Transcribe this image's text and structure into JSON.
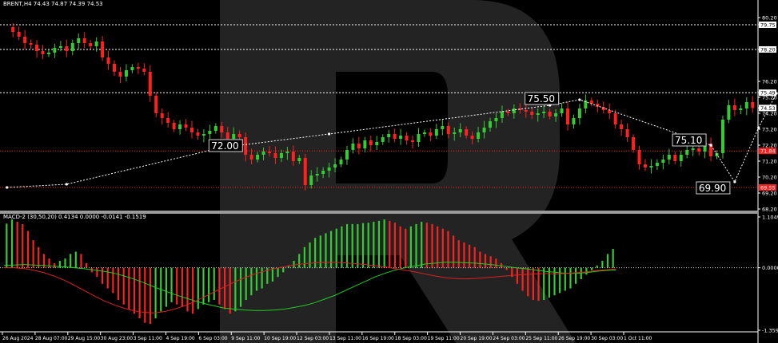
{
  "main_header": "BRENT,H4 74.43 74.87 74.39 74.53",
  "macd_header": "MACD-2 (30,50,20) 0.4134 0.0000 -0.0141 -0.1519",
  "colors": {
    "background": "#000000",
    "bull": "#33cc33",
    "bear": "#ff2020",
    "level_line": "#ff2020",
    "projection": "#ffffff",
    "signal_green": "#22cc22",
    "signal_red": "#dd2020"
  },
  "chart_data": [
    {
      "type": "candlestick",
      "symbol": "BRENT",
      "timeframe": "H4",
      "ylim": [
        68.2,
        80.7
      ],
      "y_ticks": [
        "80.20",
        "79.75",
        "78.20",
        "76.20",
        "75.49",
        "75.20",
        "74.53",
        "74.20",
        "73.20",
        "72.20",
        "71.20",
        "70.20",
        "69.20",
        "68.20"
      ],
      "x_ticks": [
        "26 Aug 2024",
        "28 Aug 07:00",
        "29 Aug 15:00",
        "30 Aug 23:00",
        "3 Sep 11:00",
        "4 Sep 19:00",
        "6 Sep 03:00",
        "9 Sep 11:00",
        "10 Sep 19:00",
        "12 Sep 03:00",
        "13 Sep 11:00",
        "16 Sep 19:00",
        "18 Sep 03:00",
        "19 Sep 11:00",
        "20 Sep 19:00",
        "24 Sep 03:00",
        "25 Sep 11:00",
        "26 Sep 19:00",
        "30 Sep 03:00",
        "1 Oct 11:00"
      ],
      "price_tags": [
        "79.75",
        "78.20",
        "75.49",
        "74.53",
        "71.84",
        "69.55"
      ],
      "levels": [
        79.75,
        78.2,
        75.49,
        71.84,
        69.55
      ],
      "level_styles": [
        "white",
        "white",
        "white",
        "red",
        "red"
      ],
      "annotations": [
        "72.00",
        "75.50",
        "75.10",
        "69.90",
        "78.20"
      ],
      "close_path": [
        79.6,
        79.3,
        79.0,
        78.6,
        78.5,
        78.1,
        77.9,
        78.0,
        78.3,
        78.4,
        78.1,
        78.6,
        78.9,
        78.6,
        78.4,
        78.7,
        77.7,
        77.3,
        76.8,
        76.5,
        76.9,
        77.1,
        77.0,
        76.8,
        75.3,
        74.2,
        73.9,
        73.6,
        73.2,
        73.5,
        73.3,
        73.0,
        72.8,
        72.9,
        73.1,
        73.4,
        73.0,
        72.6,
        72.9,
        72.7,
        71.6,
        71.3,
        71.6,
        71.8,
        71.7,
        71.4,
        71.7,
        71.8,
        71.2,
        71.4,
        69.7,
        70.3,
        70.4,
        70.6,
        70.8,
        71.0,
        71.3,
        71.9,
        72.3,
        72.0,
        72.5,
        72.2,
        72.4,
        72.7,
        72.9,
        72.6,
        72.8,
        72.5,
        72.4,
        72.9,
        73.0,
        72.8,
        73.2,
        73.4,
        72.9,
        73.0,
        73.2,
        72.8,
        72.6,
        73.0,
        73.3,
        73.7,
        73.9,
        74.3,
        74.2,
        74.5,
        74.4,
        74.3,
        74.1,
        74.2,
        74.3,
        74.0,
        74.2,
        74.5,
        73.5,
        73.9,
        74.5,
        75.0,
        74.8,
        74.6,
        74.4,
        74.2,
        73.5,
        73.2,
        72.7,
        71.9,
        71.0,
        70.8,
        70.9,
        71.1,
        71.3,
        71.6,
        71.2,
        71.6,
        71.9,
        72.0,
        71.8,
        72.3,
        71.5,
        71.7,
        73.8,
        74.7,
        74.4,
        74.5,
        74.9,
        74.53
      ],
      "projection_path": [
        [
          0,
          69.55
        ],
        [
          10,
          69.75
        ],
        [
          36,
          72.05
        ],
        [
          54,
          72.9
        ],
        [
          91,
          74.7
        ],
        [
          96,
          75.05
        ],
        [
          118,
          72.2
        ],
        [
          122,
          69.9
        ],
        [
          126,
          73.3
        ],
        [
          129,
          75.45
        ],
        [
          133,
          74.05
        ],
        [
          137,
          71.95
        ],
        [
          142,
          75.1
        ],
        [
          147,
          78.2
        ]
      ]
    },
    {
      "type": "macd_histogram",
      "name": "MACD-2 (30,50,20)",
      "ylim": [
        -1.3595,
        1.1049
      ],
      "y_ticks": [
        "1.1049",
        "0.0000",
        "-1.3595"
      ],
      "histogram": [
        0.96,
        1.05,
        1.0,
        0.95,
        0.8,
        0.6,
        0.45,
        0.3,
        0.2,
        0.1,
        0.15,
        0.2,
        0.3,
        0.35,
        0.3,
        0.1,
        -0.1,
        -0.2,
        -0.35,
        -0.45,
        -0.55,
        -0.7,
        -0.8,
        -0.9,
        -1.0,
        -1.1,
        -1.2,
        -1.22,
        -1.1,
        -0.95,
        -0.85,
        -0.75,
        -0.8,
        -0.85,
        -0.95,
        -1.0,
        -0.9,
        -0.8,
        -0.75,
        -0.7,
        -0.8,
        -0.9,
        -1.0,
        -0.95,
        -0.85,
        -0.7,
        -0.6,
        -0.5,
        -0.45,
        -0.35,
        -0.3,
        -0.2,
        -0.1,
        0.05,
        0.15,
        0.3,
        0.45,
        0.55,
        0.65,
        0.7,
        0.75,
        0.8,
        0.85,
        0.9,
        0.95,
        0.95,
        0.95,
        0.97,
        0.98,
        1.0,
        1.02,
        1.05,
        1.02,
        0.98,
        0.9,
        0.85,
        0.9,
        0.95,
        1.0,
        0.98,
        0.95,
        0.9,
        0.85,
        0.8,
        0.7,
        0.6,
        0.55,
        0.5,
        0.45,
        0.35,
        0.3,
        0.25,
        0.2,
        0.1,
        -0.05,
        -0.2,
        -0.35,
        -0.5,
        -0.62,
        -0.7,
        -0.72,
        -0.7,
        -0.65,
        -0.6,
        -0.55,
        -0.5,
        -0.45,
        -0.35,
        -0.25,
        -0.15,
        -0.05,
        0.05,
        0.15,
        0.3,
        0.41
      ],
      "signal": [
        0.05,
        0.06,
        0.07,
        0.06,
        0.05,
        0.03,
        0.02,
        0.0,
        -0.02,
        -0.05,
        -0.08,
        -0.12,
        -0.18,
        -0.25,
        -0.33,
        -0.42,
        -0.5,
        -0.58,
        -0.65,
        -0.72,
        -0.78,
        -0.83,
        -0.88,
        -0.9,
        -0.92,
        -0.93,
        -0.93,
        -0.92,
        -0.9,
        -0.86,
        -0.82,
        -0.76,
        -0.68,
        -0.6,
        -0.5,
        -0.4,
        -0.3,
        -0.2,
        -0.12,
        -0.05,
        0.0,
        0.04,
        0.08,
        0.1,
        0.12,
        0.12,
        0.11,
        0.1,
        0.08,
        0.06,
        0.03,
        0.0,
        -0.02,
        -0.05,
        -0.08,
        -0.1,
        -0.12,
        -0.12,
        -0.11,
        -0.08,
        -0.06,
        -0.05
      ],
      "macd_line": [
        0.0,
        0.0,
        -0.02,
        -0.06,
        -0.12,
        -0.2,
        -0.3,
        -0.42,
        -0.55,
        -0.68,
        -0.8,
        -0.9,
        -0.98,
        -1.04,
        -1.08,
        -1.09,
        -1.06,
        -1.0,
        -0.92,
        -0.82,
        -0.7,
        -0.58,
        -0.46,
        -0.34,
        -0.24,
        -0.15,
        -0.08,
        -0.02,
        0.03,
        0.07,
        0.1,
        0.12,
        0.13,
        0.13,
        0.12,
        0.1,
        0.08,
        0.05,
        0.02,
        -0.02,
        -0.06,
        -0.1,
        -0.15,
        -0.2,
        -0.24,
        -0.26,
        -0.27,
        -0.26,
        -0.24,
        -0.22,
        -0.2,
        -0.18,
        -0.16,
        -0.15,
        -0.14,
        -0.15,
        -0.14,
        -0.12,
        -0.1,
        -0.07,
        -0.05,
        -0.03
      ]
    }
  ]
}
